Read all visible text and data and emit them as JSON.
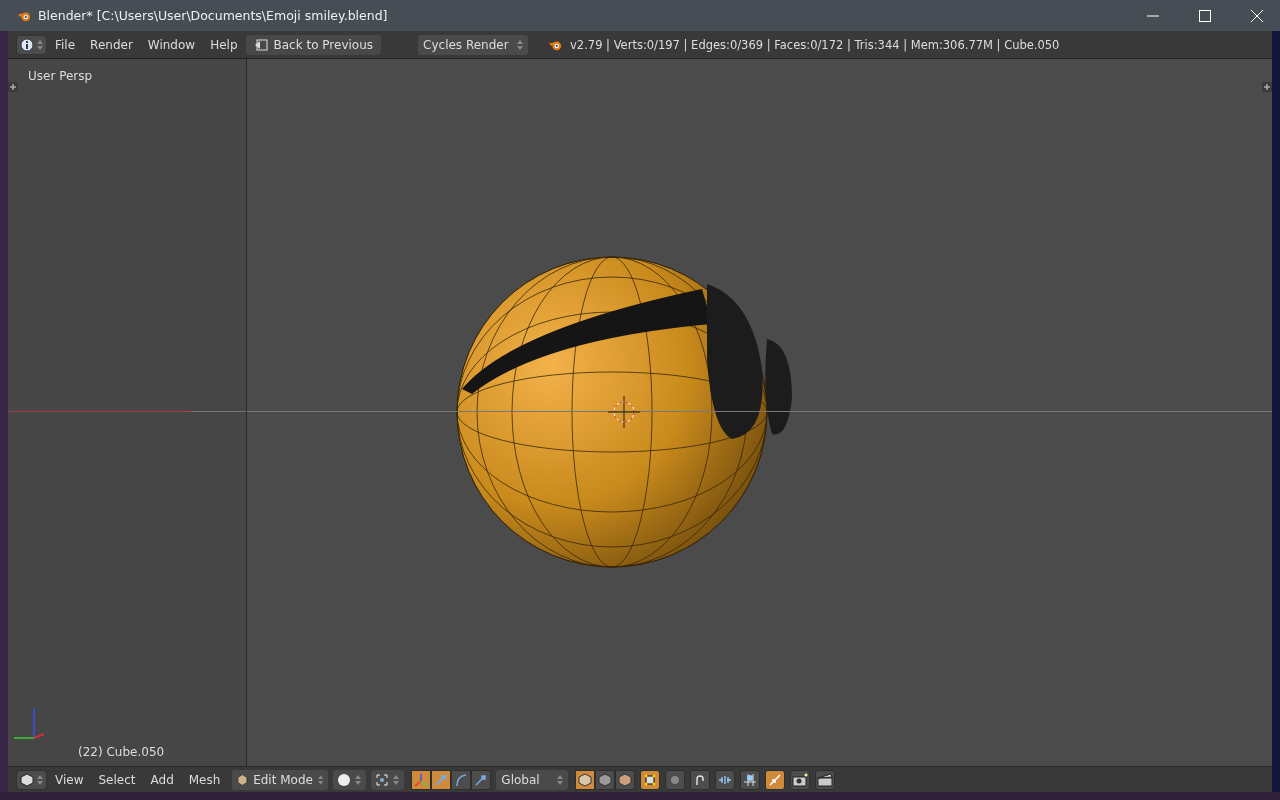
{
  "window": {
    "title": "Blender* [C:\\Users\\User\\Documents\\Emoji smiley.blend]"
  },
  "top_header": {
    "menus": [
      "File",
      "Render",
      "Window",
      "Help"
    ],
    "back_button": "Back to Previous",
    "render_engine": "Cycles Render",
    "stats": "v2.79 | Verts:0/197 | Edges:0/369 | Faces:0/172 | Tris:344 | Mem:306.77M | Cube.050"
  },
  "viewport": {
    "view_name": "User Persp",
    "object_label": "(22) Cube.050"
  },
  "bottom_header": {
    "menus": [
      "View",
      "Select",
      "Add",
      "Mesh"
    ],
    "mode": "Edit Mode",
    "orientation": "Global",
    "manipulators": [
      {
        "kind": "manipulator",
        "on": true
      },
      {
        "kind": "translate",
        "on": true
      },
      {
        "kind": "rotate",
        "on": false
      },
      {
        "kind": "scale",
        "on": false
      }
    ],
    "select_modes": [
      {
        "kind": "vertex",
        "on": true
      },
      {
        "kind": "edge",
        "on": false
      },
      {
        "kind": "face",
        "on": false
      }
    ],
    "limit_visible": {
      "on": true
    },
    "snapping": [
      {
        "kind": "proportional",
        "on": false
      },
      {
        "kind": "magnet",
        "on": false
      },
      {
        "kind": "snap-element",
        "on": false
      },
      {
        "kind": "snap-target",
        "on": false
      },
      {
        "kind": "retopo",
        "on": true
      }
    ]
  }
}
